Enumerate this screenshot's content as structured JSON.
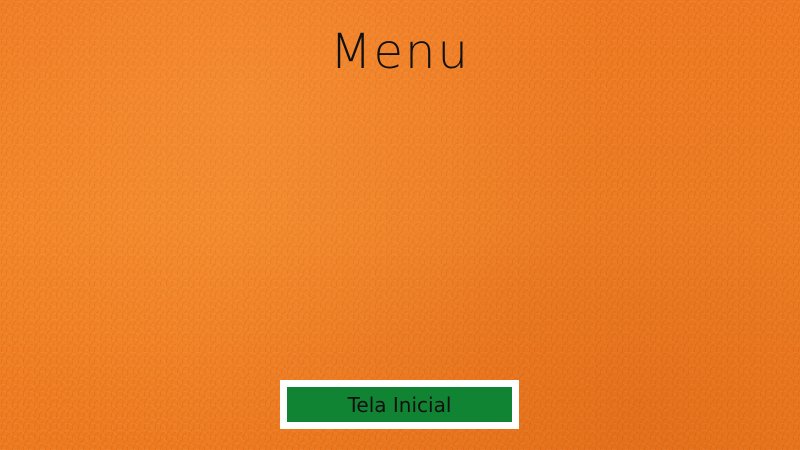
{
  "screen": {
    "title": "Menu",
    "background_color": "#f07820"
  },
  "home_button": {
    "label": "Tela Inicial",
    "fill_color": "#118434",
    "frame_color": "#ffffff"
  }
}
